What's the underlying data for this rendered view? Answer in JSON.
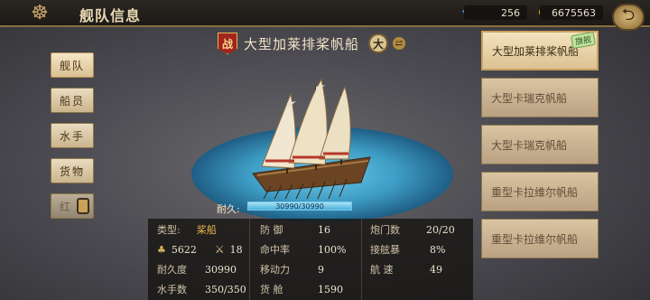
{
  "header": {
    "title": "舰队信息",
    "menu_icon": "ship-wheel-icon",
    "back_icon": "back-arrow-icon"
  },
  "resources": {
    "gems": "256",
    "gold": "6675563"
  },
  "tabs": [
    {
      "label": "舰队",
      "active": true
    },
    {
      "label": "船员",
      "active": false
    },
    {
      "label": "水手",
      "active": false
    },
    {
      "label": "货物",
      "active": false
    },
    {
      "label": "红",
      "active": false,
      "locked": true
    }
  ],
  "ship": {
    "battle_badge": "战",
    "name": "大型加莱排桨帆船",
    "size_badge": "大",
    "durability_label": "耐久:",
    "durability_text": "30990/30990",
    "durability_fraction": 1.0
  },
  "stats": {
    "type_label": "类型:",
    "type_value": "桨船",
    "food_value": "5622",
    "sword_value": "18",
    "endurance_label": "耐久度",
    "endurance_value": "30990",
    "sailors_label": "水手数",
    "sailors_value": "350/350",
    "defense_label": "防 御",
    "defense_value": "16",
    "accuracy_label": "命中率",
    "accuracy_value": "100%",
    "mobility_label": "移动力",
    "mobility_value": "9",
    "cargo_label": "货 舱",
    "cargo_value": "1590",
    "cannons_label": "炮门数",
    "cannons_value": "20/20",
    "boarding_label": "接舷暴",
    "boarding_value": "8%",
    "speed_label": "航 速",
    "speed_value": "49"
  },
  "fleet": [
    {
      "name": "大型加莱排桨帆船",
      "selected": true,
      "flag": "旗舰"
    },
    {
      "name": "大型卡瑞克帆船",
      "selected": false
    },
    {
      "name": "大型卡瑞克帆船",
      "selected": false
    },
    {
      "name": "重型卡拉维尔帆船",
      "selected": false
    },
    {
      "name": "重型卡拉维尔帆船",
      "selected": false
    }
  ]
}
